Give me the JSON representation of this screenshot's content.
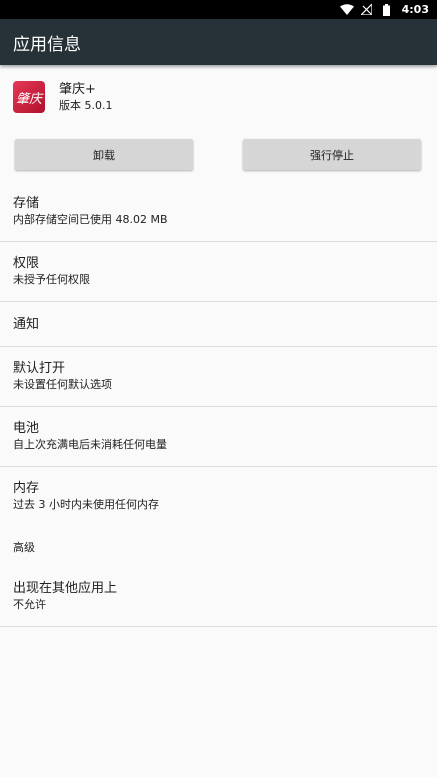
{
  "status": {
    "time": "4:03"
  },
  "appbar": {
    "title": "应用信息"
  },
  "app": {
    "icon_text": "肇庆",
    "name": "肇庆+",
    "version": "版本 5.0.1"
  },
  "buttons": {
    "uninstall": "卸载",
    "force_stop": "强行停止"
  },
  "settings": [
    {
      "title": "存储",
      "subtitle": "内部存储空间已使用 48.02 MB"
    },
    {
      "title": "权限",
      "subtitle": "未授予任何权限"
    },
    {
      "title": "通知"
    },
    {
      "title": "默认打开",
      "subtitle": "未设置任何默认选项"
    },
    {
      "title": "电池",
      "subtitle": "自上次充满电后未消耗任何电量"
    },
    {
      "title": "内存",
      "subtitle": "过去 3 小时内未使用任何内存"
    }
  ],
  "advanced": {
    "label": "高级",
    "items": [
      {
        "title": "出现在其他应用上",
        "subtitle": "不允许"
      }
    ]
  }
}
